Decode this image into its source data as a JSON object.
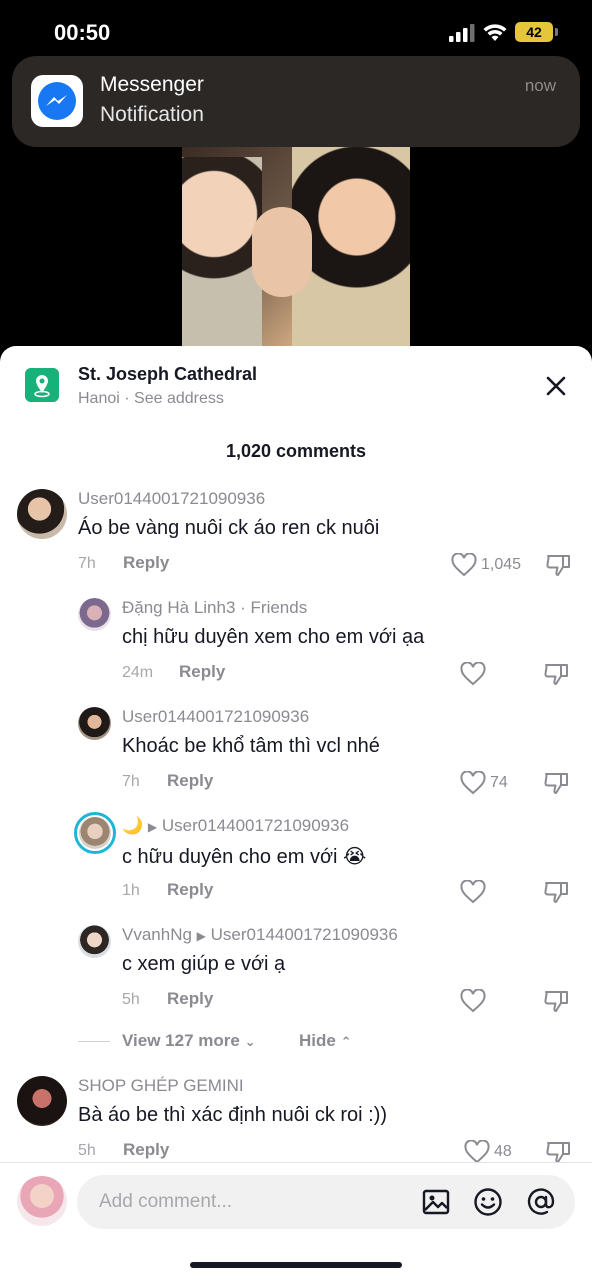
{
  "status_bar": {
    "time": "00:50",
    "battery": "42"
  },
  "notification": {
    "app": "Messenger",
    "body": "Notification",
    "when": "now"
  },
  "location": {
    "title": "St. Joseph Cathedral",
    "subtitle": "Hanoi · See address"
  },
  "comments_count": "1,020 comments",
  "comments": [
    {
      "user": "User0144001721090936",
      "text": "Áo be vàng nuôi ck áo ren ck nuôi",
      "time": "7h",
      "reply": "Reply",
      "likes": "1,045"
    },
    {
      "user": "Đặng Hà Linh3 · Friends",
      "text": "chị hữu duyên xem cho em với ạa",
      "time": "24m",
      "reply": "Reply",
      "likes": ""
    },
    {
      "user": "User0144001721090936",
      "text": "Khoác be khổ tâm thì vcl nhé",
      "time": "7h",
      "reply": "Reply",
      "likes": "74"
    },
    {
      "user": "🌙",
      "reply_to": "User0144001721090936",
      "text": "c hữu duyên cho em với 😭",
      "time": "1h",
      "reply": "Reply",
      "likes": ""
    },
    {
      "user": "VvanhNg",
      "reply_to": "User0144001721090936",
      "text": "c xem giúp e với ạ",
      "time": "5h",
      "reply": "Reply",
      "likes": ""
    },
    {
      "user": "SHOP GHÉP GEMINI",
      "text": "Bà áo be thì xác định nuôi ck roi :))",
      "time": "5h",
      "reply": "Reply",
      "likes": "48"
    }
  ],
  "view_more": "View 127 more",
  "hide": "Hide",
  "input": {
    "placeholder": "Add comment..."
  },
  "icons": {
    "location": "location-pin-icon",
    "close": "close-icon",
    "heart": "heart-icon",
    "dislike": "dislike-icon",
    "image": "image-icon",
    "emoji": "emoji-icon",
    "mention": "mention-icon"
  },
  "colors": {
    "location_green": "#18b17a",
    "messenger_blue": "#1877f2",
    "battery": "#e5c53a"
  }
}
